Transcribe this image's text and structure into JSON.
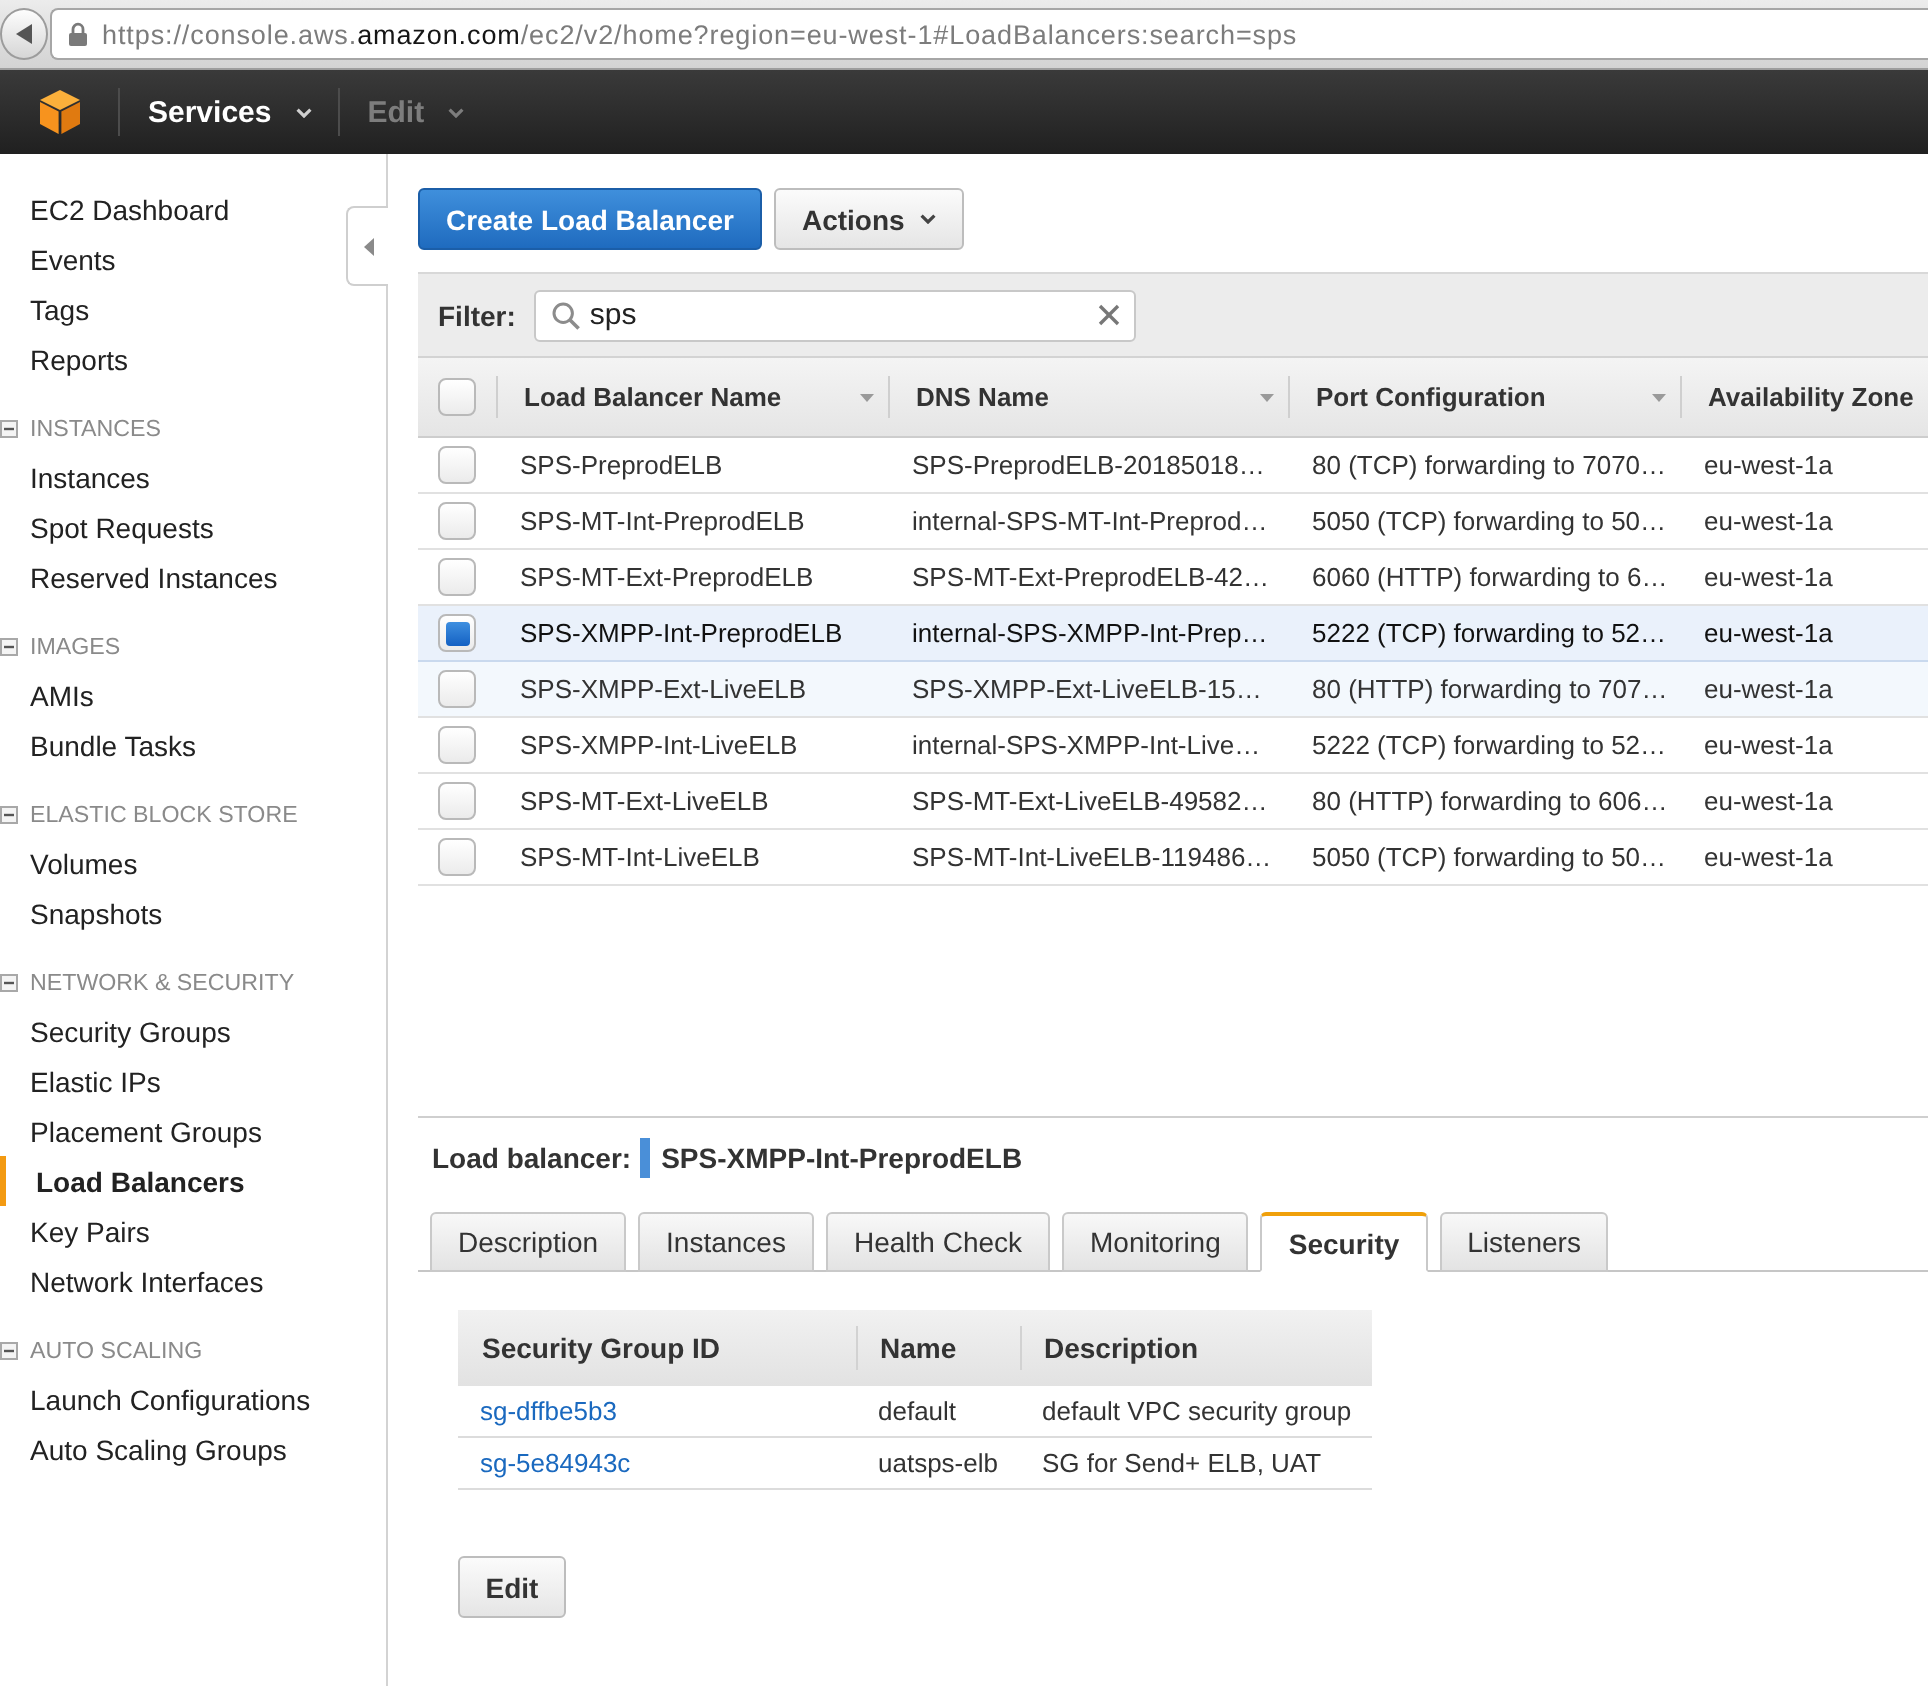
{
  "browser": {
    "url": "https://console.aws.**amazon.com**/ec2/v2/home?region=eu-west-1#LoadBalancers:search=sps"
  },
  "header": {
    "menus": [
      {
        "label": "Services",
        "disabled": false
      },
      {
        "label": "Edit",
        "disabled": true
      }
    ]
  },
  "sidebar": {
    "top_items": [
      {
        "label": "EC2 Dashboard",
        "selected": false
      },
      {
        "label": "Events",
        "selected": false
      },
      {
        "label": "Tags",
        "selected": false
      },
      {
        "label": "Reports",
        "selected": false
      }
    ],
    "sections": [
      {
        "title": "INSTANCES",
        "expanded": true,
        "items": [
          {
            "label": "Instances",
            "selected": false
          },
          {
            "label": "Spot Requests",
            "selected": false
          },
          {
            "label": "Reserved Instances",
            "selected": false
          }
        ]
      },
      {
        "title": "IMAGES",
        "expanded": true,
        "items": [
          {
            "label": "AMIs",
            "selected": false
          },
          {
            "label": "Bundle Tasks",
            "selected": false
          }
        ]
      },
      {
        "title": "ELASTIC BLOCK STORE",
        "expanded": true,
        "items": [
          {
            "label": "Volumes",
            "selected": false
          },
          {
            "label": "Snapshots",
            "selected": false
          }
        ]
      },
      {
        "title": "NETWORK & SECURITY",
        "expanded": true,
        "items": [
          {
            "label": "Security Groups",
            "selected": false
          },
          {
            "label": "Elastic IPs",
            "selected": false
          },
          {
            "label": "Placement Groups",
            "selected": false
          },
          {
            "label": "Load Balancers",
            "selected": true
          },
          {
            "label": "Key Pairs",
            "selected": false
          },
          {
            "label": "Network Interfaces",
            "selected": false
          }
        ]
      },
      {
        "title": "AUTO SCALING",
        "expanded": true,
        "items": [
          {
            "label": "Launch Configurations",
            "selected": false
          },
          {
            "label": "Auto Scaling Groups",
            "selected": false
          }
        ]
      }
    ]
  },
  "toolbar": {
    "buttons": [
      {
        "label": "Create Load Balancer",
        "kind": "primary"
      },
      {
        "label": "Actions",
        "kind": "dropdown"
      }
    ]
  },
  "filter": {
    "label": "Filter:",
    "value": "sps"
  },
  "table": {
    "all_selected": false,
    "columns": [
      {
        "label": "Load Balancer Name",
        "sortable": true
      },
      {
        "label": "DNS Name",
        "sortable": true
      },
      {
        "label": "Port Configuration",
        "sortable": true
      },
      {
        "label": "Availability Zone",
        "sortable": false
      }
    ],
    "rows": [
      {
        "selected": false,
        "hovered": false,
        "cells": [
          "SPS-PreprodELB",
          "SPS-PreprodELB-20185018…",
          "80 (TCP) forwarding to 7070…",
          "eu-west-1a"
        ]
      },
      {
        "selected": false,
        "hovered": false,
        "cells": [
          "SPS-MT-Int-PreprodELB",
          "internal-SPS-MT-Int-Preprod…",
          "5050 (TCP) forwarding to 50…",
          "eu-west-1a"
        ]
      },
      {
        "selected": false,
        "hovered": false,
        "cells": [
          "SPS-MT-Ext-PreprodELB",
          "SPS-MT-Ext-PreprodELB-42…",
          "6060 (HTTP) forwarding to 6…",
          "eu-west-1a"
        ]
      },
      {
        "selected": true,
        "hovered": false,
        "cells": [
          "SPS-XMPP-Int-PreprodELB",
          "internal-SPS-XMPP-Int-Prep…",
          "5222 (TCP) forwarding to 52…",
          "eu-west-1a"
        ]
      },
      {
        "selected": false,
        "hovered": true,
        "cells": [
          "SPS-XMPP-Ext-LiveELB",
          "SPS-XMPP-Ext-LiveELB-15…",
          "80 (HTTP) forwarding to 707…",
          "eu-west-1a"
        ]
      },
      {
        "selected": false,
        "hovered": false,
        "cells": [
          "SPS-XMPP-Int-LiveELB",
          "internal-SPS-XMPP-Int-Live…",
          "5222 (TCP) forwarding to 52…",
          "eu-west-1a"
        ]
      },
      {
        "selected": false,
        "hovered": false,
        "cells": [
          "SPS-MT-Ext-LiveELB",
          "SPS-MT-Ext-LiveELB-49582…",
          "80 (HTTP) forwarding to 606…",
          "eu-west-1a"
        ]
      },
      {
        "selected": false,
        "hovered": false,
        "cells": [
          "SPS-MT-Int-LiveELB",
          "SPS-MT-Int-LiveELB-119486…",
          "5050 (TCP) forwarding to 50…",
          "eu-west-1a"
        ]
      }
    ]
  },
  "details": {
    "label": "Load balancer:",
    "name": "SPS-XMPP-Int-PreprodELB",
    "tabs": [
      {
        "label": "Description",
        "selected": false
      },
      {
        "label": "Instances",
        "selected": false
      },
      {
        "label": "Health Check",
        "selected": false
      },
      {
        "label": "Monitoring",
        "selected": false
      },
      {
        "label": "Security",
        "selected": true
      },
      {
        "label": "Listeners",
        "selected": false
      }
    ],
    "security_groups": {
      "columns": [
        "Security Group ID",
        "Name",
        "Description"
      ],
      "rows": [
        {
          "id": "sg-dffbe5b3",
          "name": "default",
          "description": "default VPC security group"
        },
        {
          "id": "sg-5e84943c",
          "name": "uatsps-elb",
          "description": "SG for Send+ ELB, UAT"
        }
      ]
    },
    "edit_button": {
      "label": "Edit"
    }
  }
}
